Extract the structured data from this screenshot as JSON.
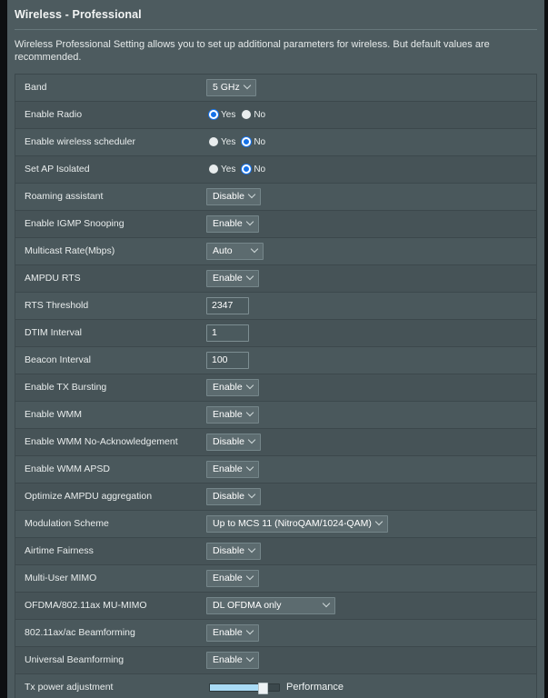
{
  "panel": {
    "title": "Wireless - Professional",
    "description": "Wireless Professional Setting allows you to set up additional parameters for wireless. But default values are recommended."
  },
  "colors": {
    "panel_bg": "#4d5b5f",
    "row_bg": "#4a585c",
    "row_alt_bg": "#465357",
    "border": "#3c484c",
    "accent_radio": "#1571e8",
    "slider_fill": "#a9dbf5",
    "text": "#e9eded"
  },
  "radio_options": {
    "yes": "Yes",
    "no": "No"
  },
  "rows": [
    {
      "label": "Band",
      "type": "select",
      "value": "5 GHz",
      "width": "w-sm"
    },
    {
      "label": "Enable Radio",
      "type": "radio",
      "selected": "yes"
    },
    {
      "label": "Enable wireless scheduler",
      "type": "radio",
      "selected": "no"
    },
    {
      "label": "Set AP Isolated",
      "type": "radio",
      "selected": "no"
    },
    {
      "label": "Roaming assistant",
      "type": "select",
      "value": "Disable",
      "width": "w-md"
    },
    {
      "label": "Enable IGMP Snooping",
      "type": "select",
      "value": "Enable",
      "width": "w-md"
    },
    {
      "label": "Multicast Rate(Mbps)",
      "type": "select",
      "value": "Auto",
      "width": "w-lg"
    },
    {
      "label": "AMPDU RTS",
      "type": "select",
      "value": "Enable",
      "width": "w-md"
    },
    {
      "label": "RTS Threshold",
      "type": "text",
      "value": "2347"
    },
    {
      "label": "DTIM Interval",
      "type": "text",
      "value": "1"
    },
    {
      "label": "Beacon Interval",
      "type": "text",
      "value": "100"
    },
    {
      "label": "Enable TX Bursting",
      "type": "select",
      "value": "Enable",
      "width": "w-md"
    },
    {
      "label": "Enable WMM",
      "type": "select",
      "value": "Enable",
      "width": "w-sm"
    },
    {
      "label": "Enable WMM No-Acknowledgement",
      "type": "select",
      "value": "Disable",
      "width": "w-md"
    },
    {
      "label": "Enable WMM APSD",
      "type": "select",
      "value": "Enable",
      "width": "w-md"
    },
    {
      "label": "Optimize AMPDU aggregation",
      "type": "select",
      "value": "Disable",
      "width": "w-md"
    },
    {
      "label": "Modulation Scheme",
      "type": "select",
      "value": "Up to MCS 11 (NitroQAM/1024-QAM)",
      "width": "w-xl"
    },
    {
      "label": "Airtime Fairness",
      "type": "select",
      "value": "Disable",
      "width": "w-md"
    },
    {
      "label": "Multi-User MIMO",
      "type": "select",
      "value": "Enable",
      "width": "w-md"
    },
    {
      "label": "OFDMA/802.11ax MU-MIMO",
      "type": "select",
      "value": "DL OFDMA only",
      "width": "w-xxl"
    },
    {
      "label": "802.11ax/ac Beamforming",
      "type": "select",
      "value": "Enable",
      "width": "w-md"
    },
    {
      "label": "Universal Beamforming",
      "type": "select",
      "value": "Enable",
      "width": "w-md"
    },
    {
      "label": "Tx power adjustment",
      "type": "slider",
      "value": "Performance",
      "percent": 78
    }
  ]
}
